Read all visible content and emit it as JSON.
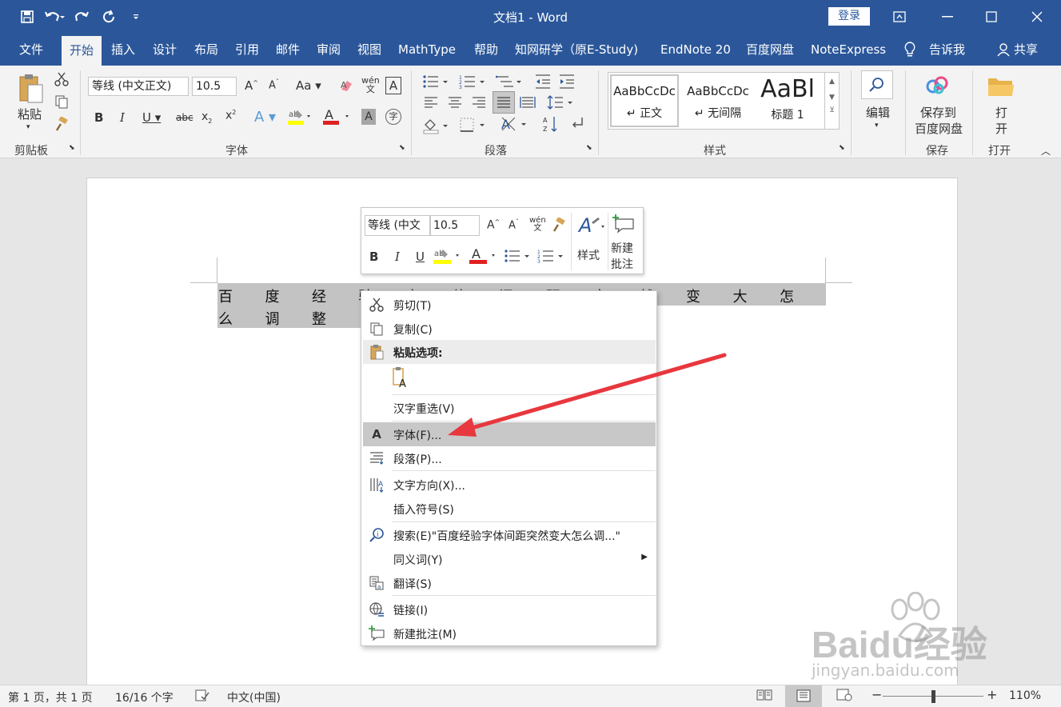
{
  "window": {
    "title": "文档1 - Word",
    "login_label": "登录"
  },
  "tabs": [
    {
      "label": "文件"
    },
    {
      "label": "开始"
    },
    {
      "label": "插入"
    },
    {
      "label": "设计"
    },
    {
      "label": "布局"
    },
    {
      "label": "引用"
    },
    {
      "label": "邮件"
    },
    {
      "label": "审阅"
    },
    {
      "label": "视图"
    },
    {
      "label": "MathType"
    },
    {
      "label": "帮助"
    },
    {
      "label": "知网研学（原E-Study)"
    },
    {
      "label": "EndNote 20"
    },
    {
      "label": "百度网盘"
    },
    {
      "label": "NoteExpress"
    },
    {
      "label": "告诉我"
    },
    {
      "label": "共享"
    }
  ],
  "ribbon": {
    "clipboard": {
      "paste_label": "粘贴",
      "group_label": "剪贴板"
    },
    "font": {
      "font_name": "等线 (中文正文)",
      "font_size": "10.5",
      "group_label": "字体"
    },
    "paragraph": {
      "group_label": "段落"
    },
    "styles": {
      "items": [
        {
          "preview": "AaBbCcDc",
          "name": "↵ 正文"
        },
        {
          "preview": "AaBbCcDc",
          "name": "↵ 无间隔"
        },
        {
          "preview": "AaBl",
          "name": "标题 1"
        }
      ],
      "group_label": "样式"
    },
    "edit": {
      "label": "编辑"
    },
    "save": {
      "label_line1": "保存到",
      "label_line2": "百度网盘",
      "group_label": "保存"
    },
    "open": {
      "label_line1": "打",
      "label_line2": "开",
      "group_label": "打开"
    }
  },
  "document": {
    "line1_chars": [
      "百",
      "度",
      "经",
      "验",
      "字",
      "体",
      "间",
      "距",
      "突",
      "然",
      "变",
      "大",
      "怎"
    ],
    "line2_chars": [
      "么",
      "调",
      "整"
    ]
  },
  "mini_toolbar": {
    "font_name": "等线 (中文",
    "font_size": "10.5",
    "styles_label": "样式",
    "new_comment_line1": "新建",
    "new_comment_line2": "批注"
  },
  "context_menu": {
    "items": [
      {
        "label": "剪切(T)"
      },
      {
        "label": "复制(C)"
      },
      {
        "label": "粘贴选项:"
      },
      {
        "label": "汉字重选(V)"
      },
      {
        "label": "字体(F)..."
      },
      {
        "label": "段落(P)..."
      },
      {
        "label": "文字方向(X)..."
      },
      {
        "label": "插入符号(S)"
      },
      {
        "label": "搜索(E)\"百度经验字体间距突然变大怎么调...\""
      },
      {
        "label": "同义词(Y)"
      },
      {
        "label": "翻译(S)"
      },
      {
        "label": "链接(I)"
      },
      {
        "label": "新建批注(M)"
      }
    ]
  },
  "status_bar": {
    "page": "第 1 页，共 1 页",
    "words": "16/16 个字",
    "language": "中文(中国)",
    "zoom": "110%"
  },
  "watermark": {
    "brand": "Baidu经验",
    "url": "jingyan.baidu.com"
  },
  "colors": {
    "accent": "#2b579a",
    "arrow": "#e8373e"
  }
}
